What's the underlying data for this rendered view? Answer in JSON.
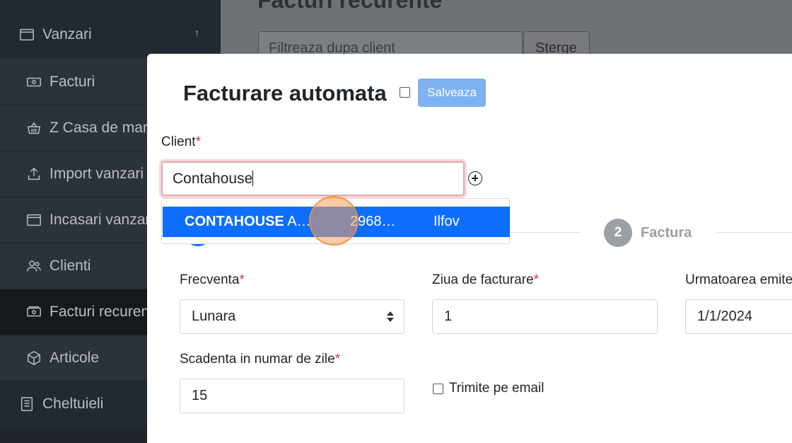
{
  "sidebar": {
    "section": {
      "label": "Vanzari",
      "icon": "window-icon",
      "expand_icon": "arrow-up-icon"
    },
    "items": [
      {
        "label": "Facturi",
        "icon": "money-icon"
      },
      {
        "label": "Z Casa de marcat",
        "icon": "basket-icon"
      },
      {
        "label": "Import vanzari",
        "icon": "upload-icon"
      },
      {
        "label": "Incasari vanzari",
        "icon": "window-icon"
      },
      {
        "label": "Clienti",
        "icon": "users-icon"
      },
      {
        "label": "Facturi recurente",
        "icon": "money-icon",
        "active": true
      },
      {
        "label": "Articole",
        "icon": "box-icon"
      }
    ],
    "bottom_item": {
      "label": "Cheltuieli",
      "icon": "receipt-icon"
    }
  },
  "background_page": {
    "title": "Facturi recurente",
    "filter_placeholder": "Filtreaza dupa client",
    "clear_button": "Sterge"
  },
  "modal": {
    "title": "Facturare automata",
    "save_button": "Salveaza",
    "client_label": "Client",
    "client_value": "Contahouse",
    "autocomplete": {
      "name_bold": "CONTAHOUSE",
      "name_rest": " A…",
      "cui": "2968…",
      "county": "Ilfov"
    },
    "steps": [
      {
        "number": "2",
        "label": "Factura"
      }
    ],
    "frequency_label": "Frecventa",
    "frequency_value": "Lunara",
    "billing_day_label": "Ziua de facturare",
    "billing_day_value": "1",
    "next_issue_label": "Urmatoarea emitere",
    "next_issue_value": "1/1/2024",
    "due_days_label": "Scadenta in numar de zile",
    "due_days_value": "15",
    "send_email_label": "Trimite pe email",
    "required_mark": "*"
  },
  "colors": {
    "sidebar_bg": "#1f252b",
    "primary": "#0d6efd",
    "save_button": "#7fb2f0",
    "required": "#dc3545",
    "step_inactive": "#9aa0a6"
  }
}
